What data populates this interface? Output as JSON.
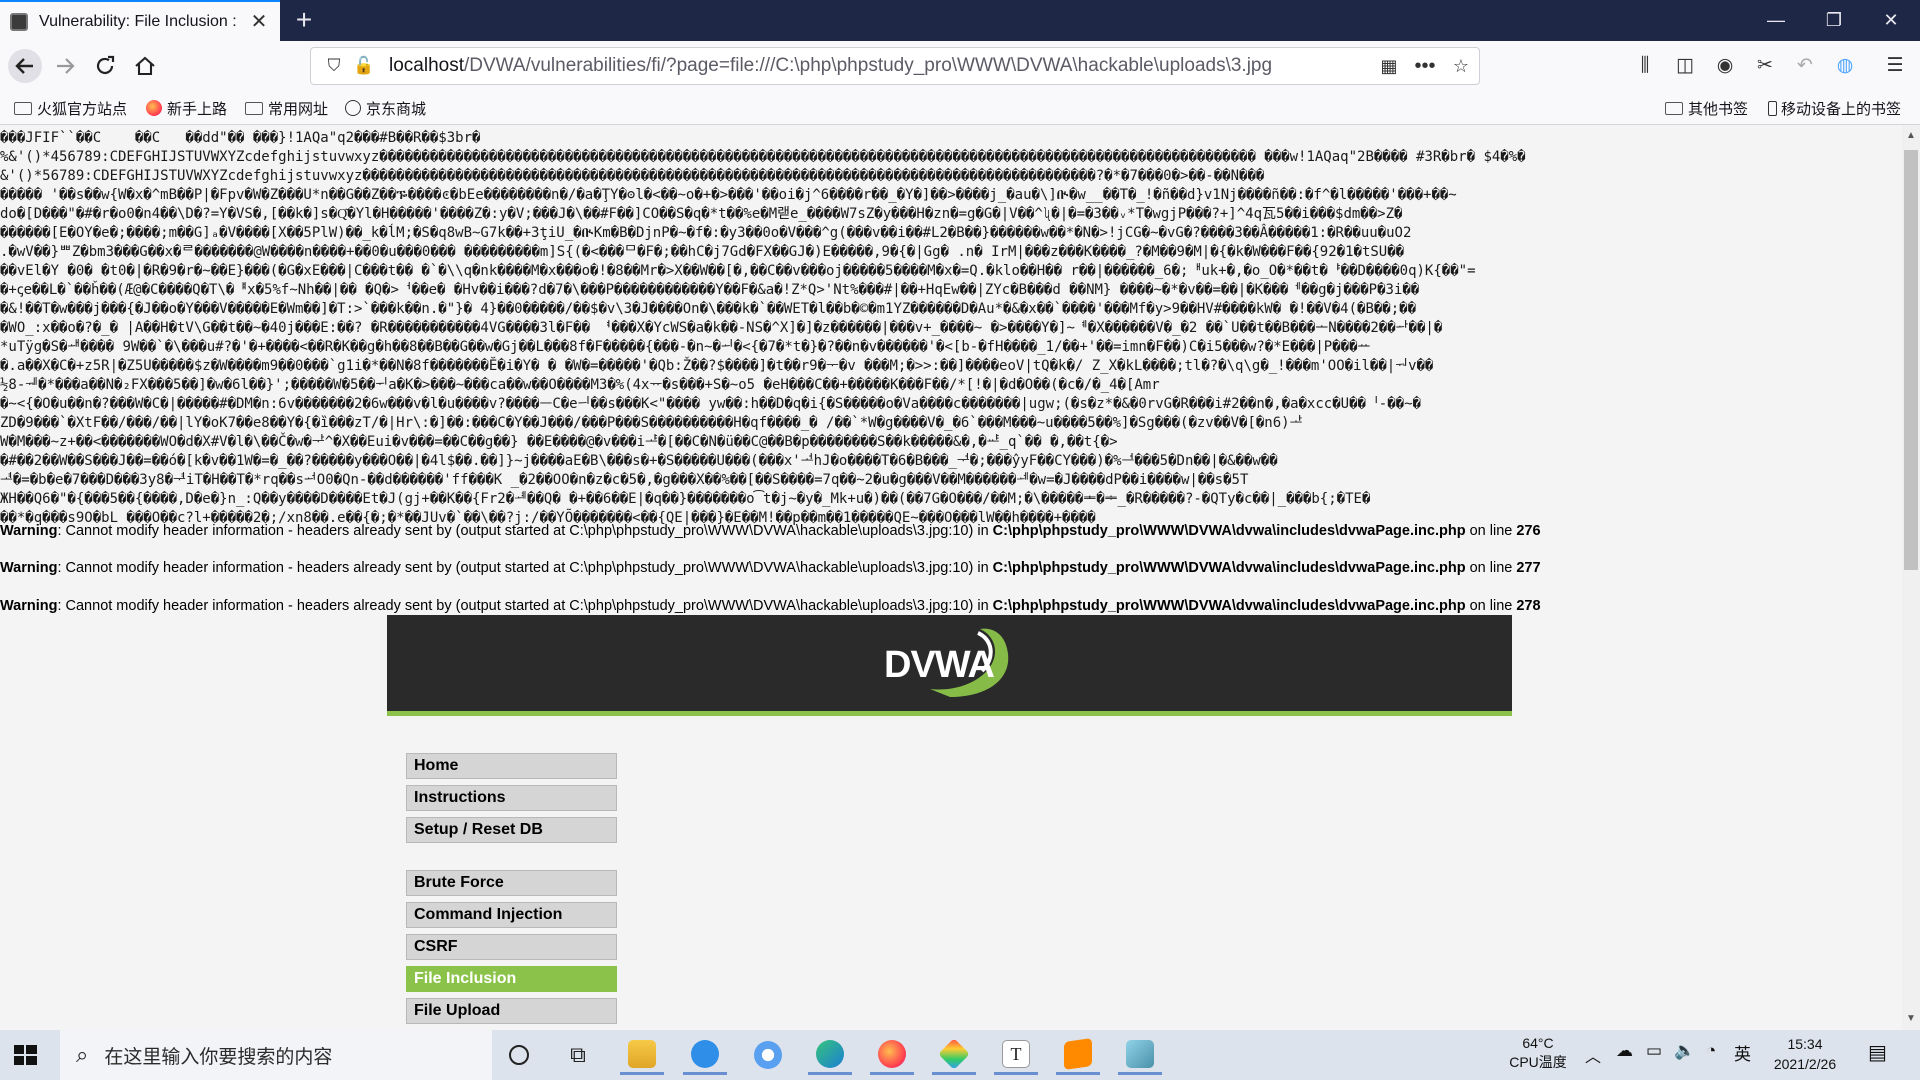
{
  "browser": {
    "tab_title": "Vulnerability: File Inclusion :",
    "new_tab_label": "+",
    "url_host": "localhost",
    "url_path": "/DVWA/vulnerabilities/fi/?page=file:///C:\\php\\phpstudy_pro\\WWW\\DVWA\\hackable\\uploads\\3.jpg",
    "window_controls": {
      "minimize": "—",
      "restore": "❐",
      "close": "✕"
    }
  },
  "bookmarks": {
    "left": [
      "火狐官方站点",
      "新手上路",
      "常用网址",
      "京东商城"
    ],
    "right": [
      "其他书签",
      "移动设备上的书签"
    ]
  },
  "page": {
    "garbage_text": "���JFIF``��C    ��C   ��dd\"�� ���}!1AQa\"q2���#B��R��$3br�\n%&'()*456789:CDEFGHIJSTUVWXYZcdefghijstuvwxyz�������������������������������������������������������������������������������������������������������� ���w!1AQaq\"2B���� #3R�br� $4�%�\n&'()*56789:CDEFGHIJSTUVWXYZcdefghijstuvwxyz���������������������������������������������������������������������������������������?�*�7���0�>��-��N���\n����� '��s��w{W�x�^mB��P|�Fpv�W�Z���U*n��G��Z��ᎏ����ͼ�bEe��������n�/�a�ŢY�ʘl�<��~o�+�>���'��oi�j^6����r��_�Y�]��>����j_�au�\\]ᎅ�w__��T�_!�ñ��d}v1Nj����ñ��:�f^�l�����'���+��~\ndo�[D���\"�#�r�o0�n4��\\D�?=Y�VS�,[��k�]s�Q͂�Yl�H�����'����Z�:y�V;���J�\\��#F��]CO��S�q�*t��%e�M랟e_����W7sZ�y���H�zn�=g�G�|V��^ʯ�|�=�3��ᵥ*T�wgjP���?+]^4q瓦5��i���$dm��>Z�\n������[E�OY�e�;����;m��G]ₐ�V����[X��5PlW)��_k�ĺM;�S�q8wB~G7k��+3ţiU_�ᎅKm�B�DjnP�~�f�:�y3��0o�V���^g(���v��i��#L2�B��}������w��*�N�>!jCG�~�vG�?����3��Â�����1:�R��uu�uO2\n.�wV��}ᄈZ�bm3���G��x�ᄅ�������@W����n����+��0�u���0��� ���������m]S{(�<���ᄆ�F�;��hC�j7Gd�FX��GJ�)E�����,9�{�|Gg� .n� IrM|���z���K����_?�M��9�M|�{�k�W���F��{92�1�tSU��\n��vEl�Y �0� �t0�|�R�9�r�~��E}���(�G�xE���|C���t�� �`�\\\\q�nk����M�x���o�!�8��Mr�>X��W��[�,��C��v���oj�����5����M�x�=Q.�klo��H�� r��|������_6�;ᅢuk+�,�o_O�*��t�ᅣ��D����0q)K{��\"=\n�+ꞔe��L�`��ȟ��(Æ@�C����Q�T\\�ᅤx�5%f~Nh��|�� �Q�>ᅥ��e� �Hv��i���?d�7�\\���P������������Y��F�&a�!Z*Q>'Nt%���#|��+HqEw��|ZYc�B���d ��NM} ����~�*�v��=��|�K���ᅦ��g�j���P�3i��\n�&!��T�w���j���{�J��o�Y���V�����E�Wm��]�T:>`���k��n.�\"}� 4}��0�����/��$�v\\3�J����On�\\���k�`��WET�l��b�©�m1YZ������D�Au*�&�x��`����'���Mf�y>9��HV#����kW� �!��V�4(�B��;��\n�WO_:x��o�?�_� |A��H�tV\\G��t��~�40j���E:��? �R�����������4VG����3l�F�� ᅧ���X�YcWS�a�k��-NS�^X]�]�z������|���v+_����~ �>����Y�]~ᅨ�X������V�_�2 ��`U��t��B���ᅩN����2��ᅪ��|�\n*uTÿg�S�ᅫ���� 9W��`�\\���u#?�'�+����<��R�K��g�h��8��B��G��w�Gj��L���8f�F�����{���-�n~�ᅬ�<{�7�*t�}�?��n�v������'�<[b-�fH����_1/��+'��=imn�F��)C�i5���w?�*E���|P���ᅭ\n�.a��X�C�+z5R|�Z5U�����$z�W����m9��0���`g1i�*��N�8f�������Ĕ�i�Y� � �W�=�����'�Qb:Ž��?$����]�t��r9�ᅮ�v ���M;�>>:��]����eoV|tQ�k�/ Z_X�kL����;tl�?�\\q\\g�_!���m'OO�il��|ᅯv��\n½8-ᅰ�*���a��N�₂FX���5��]�w�6l��}';�����W�5��ᅱa�K�>���~���ca��w��O����M3�%(4xᅲ�s���+S�~o5 �eH���C��+�����K���F��/*[!�|�d�O��(�c�/�_4�[Amr\n�~<{�O�u��n�?���W�C�|�����#�DM�n:6v�������2�6w���v�l�u����v?����ᅳC�eᅴ��s���K<\"���� yw��:h��D�q�i{�S�����o�Va����c�������|ugw;(�s�z*�&�0rvG�R���i#2��n�,�a�xcc�U��ᅵ-��~�\nZD�9���`�XtF��/���/��|lY�oK7��e8��Y�{�ȉ���zT/�|Hr\\:�]��:���C�Y��J���/���P���S����������H�qf����_� /��`*W�g����V�_�6`���M���~u����5��%]�Sg���(�zv��V�[�n6)ᅶ\nW�M���~z+��<�������WO�d�X#V�l�\\��Č�w�ᅷ^�X��Eui�v���=��C��g��} ��E����@�v���iᅸ�[��C�N�ü��C@��B�p��������S��k�����&�,�ᅹ_q`�� �,��t{�>\n�#��2��W��S���J��=��ó�[k�v��1W�=�_��?�����y���O��|�4l$��.��]}~j����aE�B\\���s�+�S�����U���(���x'ᅺhJ�o����T�6�B���_ᅻ�;���ŷyF��CY���)�%ᅼ���5�Dn��|�&��w��\nᅽ�=�b�e�7���D���3y8�ᅾiT�H��T�*rq��sᅿO0�Qn-��d������'ff���K _�2��OO�n�z�c�5�,�g���X��%��[��S����=7q��~2�u�g���V��M������ᆀ�w=�J����dP��i����w|��s�5T\nЖH��Q6�\"�{���5��{����,D�e�}n_:Q��y����D����Et�J(gj+��K��{Fr2�ᆁ��Q� �+��6��E|�q��}�������o͡t�j~�y�_Mk+u�)��(��7G�O���/��M;�\\�����ᆂ�ᆃ_�R�����?-�QTy�c��|_���b{;�TE�\n��*�q���s9O�bL ���O��c?l+�����2�;/xn8��.e��{�;�*��JUv�`��\\��?j:/��YÕ�������<��{QE|���}�E��M!��p��m��1�����QE~���O���lW��h����+����"
  },
  "warnings": [
    {
      "label": "Warning",
      "message": ": Cannot modify header information - headers already sent by (output started at C:\\php\\phpstudy_pro\\WWW\\DVWA\\hackable\\uploads\\3.jpg:10) in ",
      "file": "C:\\php\\phpstudy_pro\\WWW\\DVWA\\dvwa\\includes\\dvwaPage.inc.php",
      "line_text": " on line ",
      "line": "276"
    },
    {
      "label": "Warning",
      "message": ": Cannot modify header information - headers already sent by (output started at C:\\php\\phpstudy_pro\\WWW\\DVWA\\hackable\\uploads\\3.jpg:10) in ",
      "file": "C:\\php\\phpstudy_pro\\WWW\\DVWA\\dvwa\\includes\\dvwaPage.inc.php",
      "line_text": " on line ",
      "line": "277"
    },
    {
      "label": "Warning",
      "message": ": Cannot modify header information - headers already sent by (output started at C:\\php\\phpstudy_pro\\WWW\\DVWA\\hackable\\uploads\\3.jpg:10) in ",
      "file": "C:\\php\\phpstudy_pro\\WWW\\DVWA\\dvwa\\includes\\dvwaPage.inc.php",
      "line_text": " on line ",
      "line": "278"
    }
  ],
  "dvwa": {
    "logo_text": "DVWA",
    "accent_color": "#8bc34a",
    "header_bg": "#2a2a2a",
    "menu": [
      {
        "label": "Home",
        "active": false
      },
      {
        "label": "Instructions",
        "active": false
      },
      {
        "label": "Setup / Reset DB",
        "active": false
      },
      {
        "label": "Brute Force",
        "active": false
      },
      {
        "label": "Command Injection",
        "active": false
      },
      {
        "label": "CSRF",
        "active": false
      },
      {
        "label": "File Inclusion",
        "active": true
      },
      {
        "label": "File Upload",
        "active": false
      }
    ]
  },
  "taskbar": {
    "search_placeholder": "在这里输入你要搜索的内容",
    "weather_temp": "64°C",
    "weather_label": "CPU温度",
    "ime": "英",
    "time": "15:34",
    "date": "2021/2/26",
    "apps": [
      "task-view-icon",
      "file-explorer-icon",
      "app-blue-icon",
      "app-baidu-icon",
      "edge-icon",
      "firefox-icon",
      "app-diamond-icon",
      "typora-icon",
      "sublime-icon",
      "app-notepad-icon"
    ]
  }
}
